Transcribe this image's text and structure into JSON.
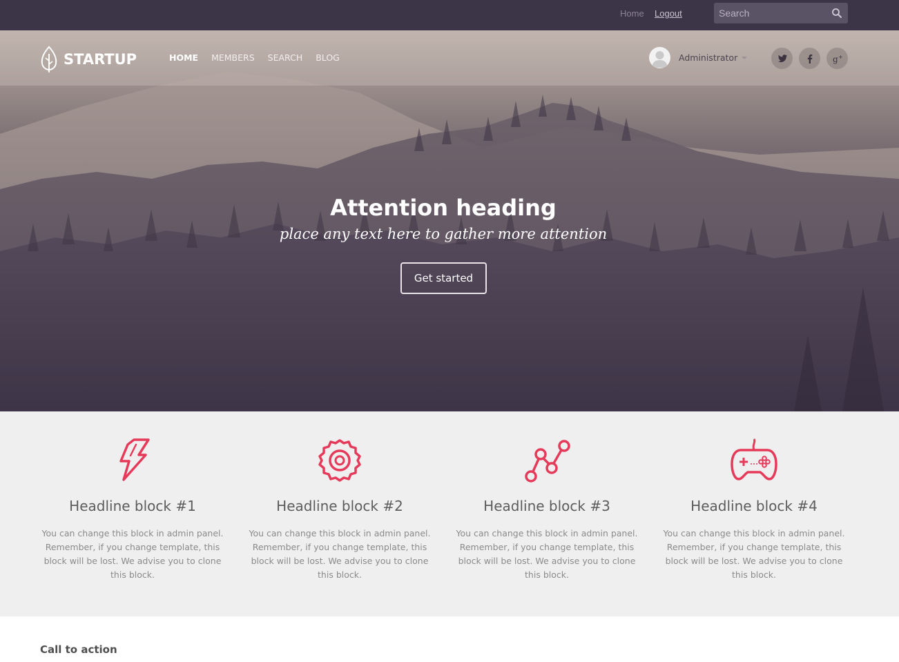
{
  "topbar": {
    "home_link": "Home",
    "logout_link": "Logout",
    "search_placeholder": "Search"
  },
  "brand": {
    "name": "STARTUP"
  },
  "nav": {
    "items": [
      {
        "label": "HOME",
        "active": true
      },
      {
        "label": "MEMBERS",
        "active": false
      },
      {
        "label": "SEARCH",
        "active": false
      },
      {
        "label": "BLOG",
        "active": false
      }
    ]
  },
  "user": {
    "name": "Administrator"
  },
  "social": [
    "twitter-icon",
    "facebook-icon",
    "google-plus-icon"
  ],
  "hero": {
    "title": "Attention heading",
    "subtitle": "place any text here to gather more attention",
    "button": "Get started"
  },
  "features": [
    {
      "title": "Headline block #1",
      "text": "You can change this block in admin panel. Remember, if you change template, this block will be lost. We advise you to clone this block.",
      "icon": "lightning-icon"
    },
    {
      "title": "Headline block #2",
      "text": "You can change this block in admin panel. Remember, if you change template, this block will be lost. We advise you to clone this block.",
      "icon": "gear-icon"
    },
    {
      "title": "Headline block #3",
      "text": "You can change this block in admin panel. Remember, if you change template, this block will be lost. We advise you to clone this block.",
      "icon": "line-graph-icon"
    },
    {
      "title": "Headline block #4",
      "text": "You can change this block in admin panel. Remember, if you change template, this block will be lost. We advise you to clone this block.",
      "icon": "gamepad-icon"
    }
  ],
  "call_to_action": {
    "title": "Call to action"
  },
  "colors": {
    "accent": "#e63a5a",
    "topbar": "#3c3547",
    "features_bg": "#efefef"
  }
}
